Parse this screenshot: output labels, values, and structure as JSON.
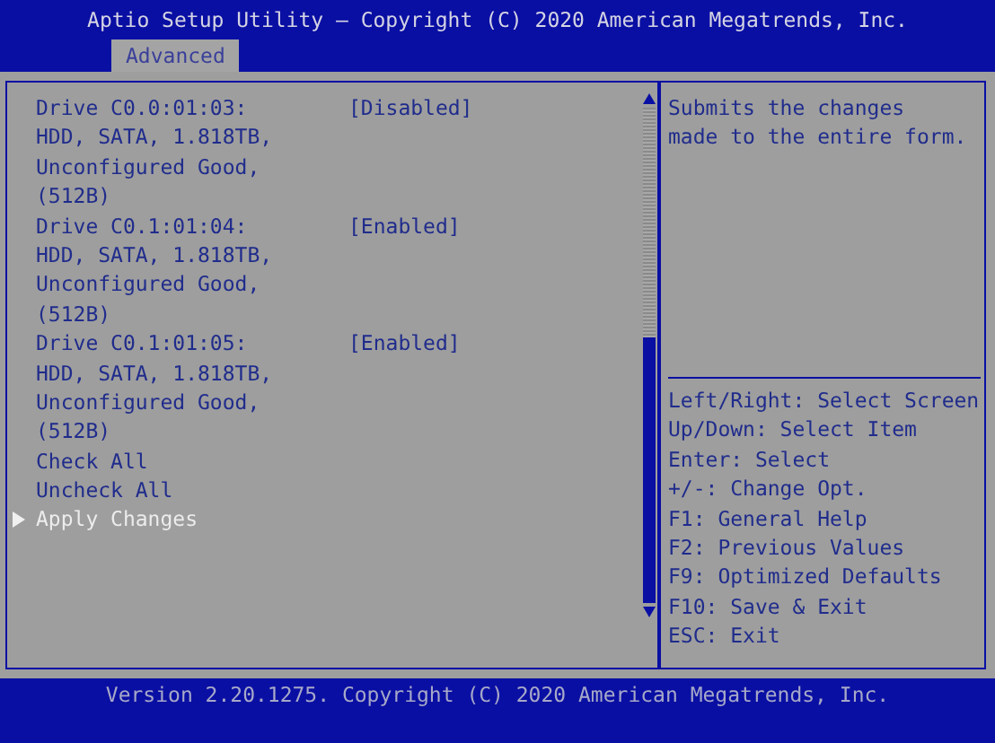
{
  "header": {
    "title": "Aptio Setup Utility – Copyright (C) 2020 American Megatrends, Inc.",
    "tabs": [
      {
        "label": "Advanced",
        "selected": true
      }
    ]
  },
  "items": [
    {
      "kind": "setting",
      "lines": [
        "Drive C0.0:01:03:",
        "HDD, SATA, 1.818TB,",
        "Unconfigured Good,",
        "(512B)"
      ],
      "value": "[Disabled]",
      "selected": false
    },
    {
      "kind": "setting",
      "lines": [
        "Drive C0.1:01:04:",
        "HDD, SATA, 1.818TB,",
        "Unconfigured Good,",
        "(512B)"
      ],
      "value": "[Enabled]",
      "selected": false
    },
    {
      "kind": "setting",
      "lines": [
        "Drive C0.1:01:05:",
        "HDD, SATA, 1.818TB,",
        "Unconfigured Good,",
        "(512B)"
      ],
      "value": "[Enabled]",
      "selected": false
    },
    {
      "kind": "action",
      "lines": [
        "Check All"
      ],
      "selected": false
    },
    {
      "kind": "action",
      "lines": [
        "Uncheck All"
      ],
      "selected": false
    },
    {
      "kind": "action",
      "lines": [
        "Apply Changes"
      ],
      "selected": true
    }
  ],
  "help": {
    "description": [
      "Submits the changes",
      "made to the entire form."
    ],
    "keys": [
      "Left/Right: Select Screen",
      "Up/Down: Select Item",
      "Enter: Select",
      "+/-: Change Opt.",
      "F1: General Help",
      "F2: Previous Values",
      "F9: Optimized Defaults",
      "F10: Save & Exit",
      "ESC: Exit"
    ]
  },
  "footer": "Version 2.20.1275. Copyright (C) 2020 American Megatrends, Inc."
}
